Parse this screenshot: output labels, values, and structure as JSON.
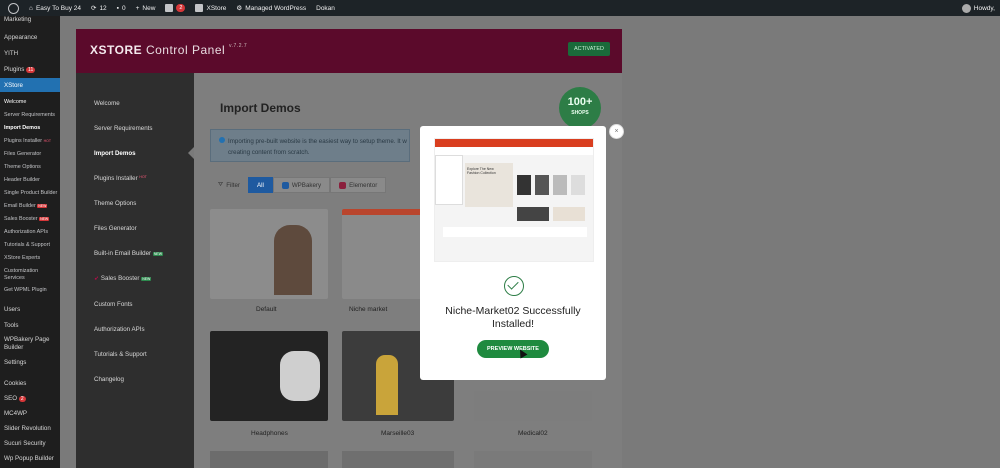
{
  "admin_bar": {
    "site_name": "Easy To Buy 24",
    "updates_count": "12",
    "comments_count": "0",
    "new_label": "New",
    "woo_badge": "2",
    "xstore_label": "XStore",
    "managed_wp_label": "Managed WordPress",
    "dokan_label": "Dokan",
    "howdy_label": "Howdy,"
  },
  "admin_menu": {
    "items": [
      "Marketing",
      "Appearance",
      "YITH",
      "Plugins",
      "XStore",
      "Users",
      "Tools",
      "WPBakery Page Builder",
      "Settings",
      "Cookies",
      "SEO",
      "MC4WP",
      "Slider Revolution",
      "Sucuri Security",
      "Wp Popup Builder"
    ],
    "plugins_count": "11",
    "seo_count": "2",
    "xstore_sub": [
      "Welcome",
      "Server Requirements",
      "Import Demos",
      "Plugins Installer",
      "Files Generator",
      "Theme Options",
      "Header Builder",
      "Single Product Builder",
      "Email Builder",
      "Sales Booster",
      "Authorization APIs",
      "Tutorials & Support",
      "XStore Experts",
      "Customization Services",
      "Get WPML Plugin"
    ],
    "hot_label": "HOT",
    "new_label": "NEW"
  },
  "panel": {
    "logo_bold": "XSTORE",
    "logo_rest": " Control Panel",
    "version": "v.7.2.7",
    "activated": "ACTIVATED"
  },
  "xstore_nav": {
    "items": [
      "Welcome",
      "Server Requirements",
      "Import Demos",
      "Plugins Installer",
      "Theme Options",
      "Files Generator",
      "Built-in Email Builder",
      "Sales Booster",
      "Custom Fonts",
      "Authorization APIs",
      "Tutorials & Support",
      "Changelog"
    ],
    "hot": "HOT",
    "new": "NEW"
  },
  "main": {
    "title": "Import Demos",
    "badge_num": "100+",
    "badge_sub": "SHOPS",
    "info_line1": "Importing pre-built website is the easiest way to setup theme. It w",
    "info_line2": "creating content from scratch.",
    "filter_label": "Filter",
    "tab_all": "All",
    "tab_wpbakery": "WPBakery",
    "tab_elementor": "Elementor",
    "demos": [
      "Default",
      "Niche market",
      "Headphones",
      "Marseille03",
      "Medical02"
    ]
  },
  "modal": {
    "title_line1": "Niche-Market02 Successfully",
    "title_line2": "Installed!",
    "button": "PREVIEW WEBSITE",
    "close": "×",
    "preview_text": "Explore The New Fashion Collection"
  },
  "colors": {
    "accent": "#2271b1",
    "panel_header": "#5b0a2b",
    "success": "#1f8a3f"
  }
}
